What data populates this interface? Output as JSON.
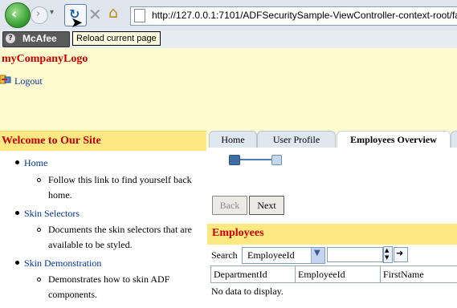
{
  "browser": {
    "address_url": "http://127.0.0.1:7101/ADFSecuritySample-ViewController-context-root/faces/",
    "tooltip": "Reload current page",
    "toolbar_plugin": "McAfee"
  },
  "header": {
    "logo": "myCompanyLogo",
    "logout": "Logout"
  },
  "welcome": {
    "title": "Welcome to Our Site",
    "items": [
      {
        "link": "Home",
        "description": "Follow this link to find yourself back home."
      },
      {
        "link": "Skin Selectors",
        "description": "Documents the skin selectors that are available to be styled."
      },
      {
        "link": "Skin Demonstration",
        "description": "Demonstrates how to skin ADF components."
      }
    ]
  },
  "tabs": [
    {
      "label": "Home"
    },
    {
      "label": "User Profile"
    },
    {
      "label": "Employees Overview"
    }
  ],
  "train": {
    "back_label": "Back",
    "next_label": "Next"
  },
  "employees": {
    "title": "Employees",
    "search_label": "Search",
    "search_field": "EmployeeId",
    "columns": [
      "DepartmentId",
      "EmployeeId",
      "FirstName"
    ],
    "empty_message": "No data to display."
  }
}
